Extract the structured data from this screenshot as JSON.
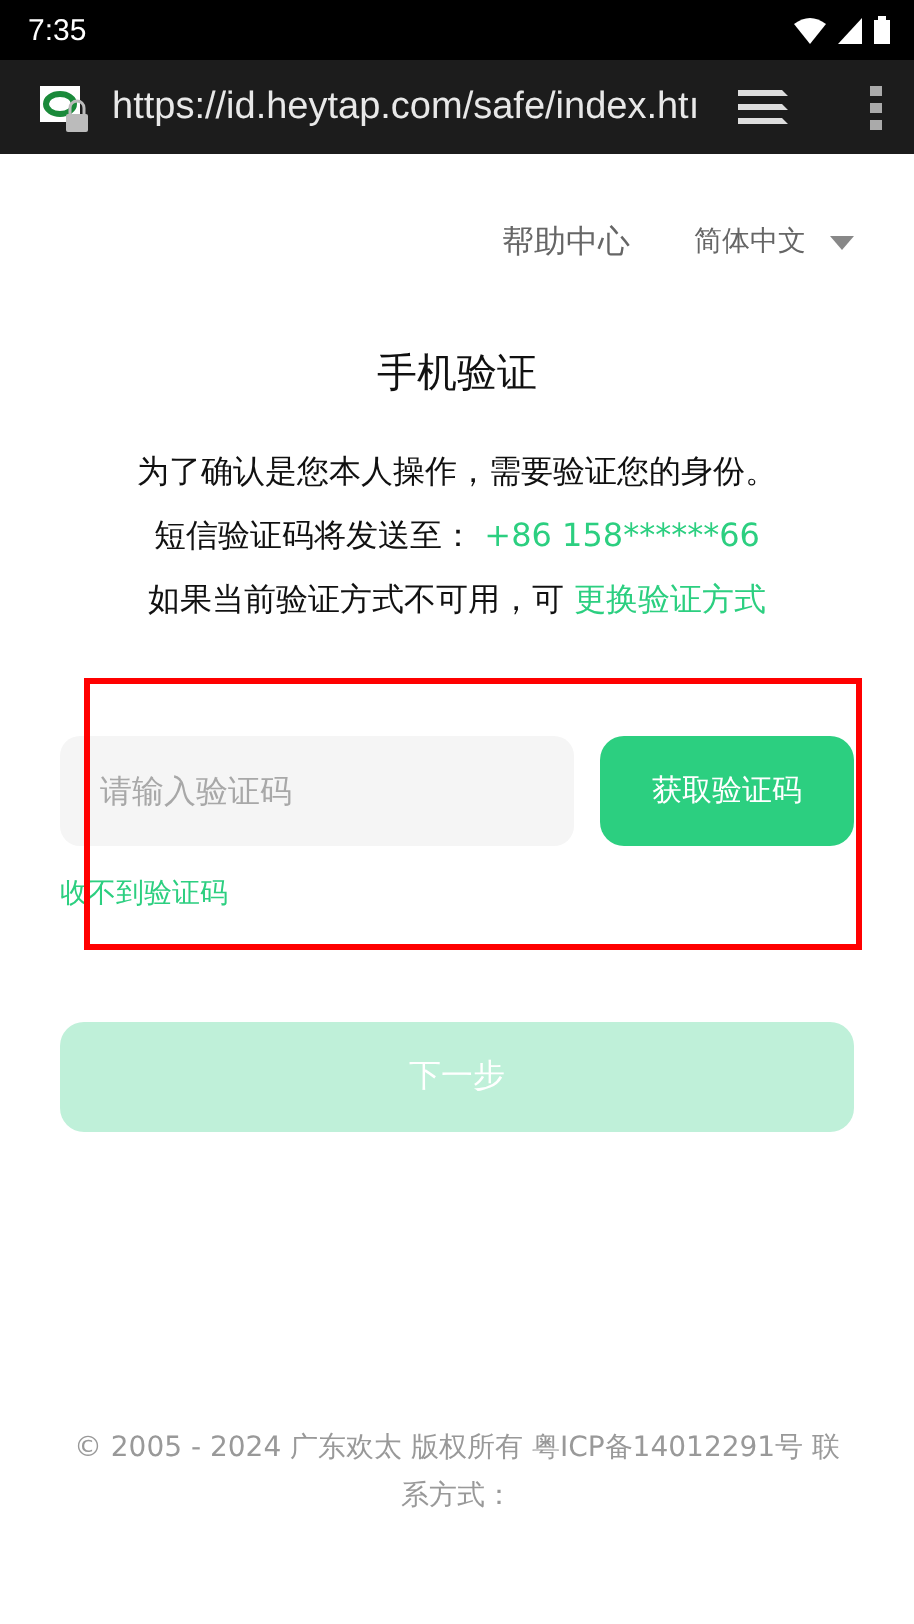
{
  "status_bar": {
    "time": "7:35"
  },
  "browser": {
    "url": "https://id.heytap.com/safe/index.htı"
  },
  "header": {
    "help": "帮助中心",
    "language": "简体中文"
  },
  "title": "手机验证",
  "intro": "为了确认是您本人操作，需要验证您的身份。",
  "sms": {
    "label": "短信验证码将发送至：",
    "phone": "+86 158******66"
  },
  "alternative": {
    "text": "如果当前验证方式不可用，可",
    "link": "更换验证方式"
  },
  "code_field": {
    "placeholder": "请输入验证码"
  },
  "get_code_button": "获取验证码",
  "no_code_link": "收不到验证码",
  "next_button": {
    "label": "下一步",
    "disabled": true
  },
  "footer": "© 2005 - 2024 广东欢太 版权所有 粤ICP备14012291号 联系方式："
}
